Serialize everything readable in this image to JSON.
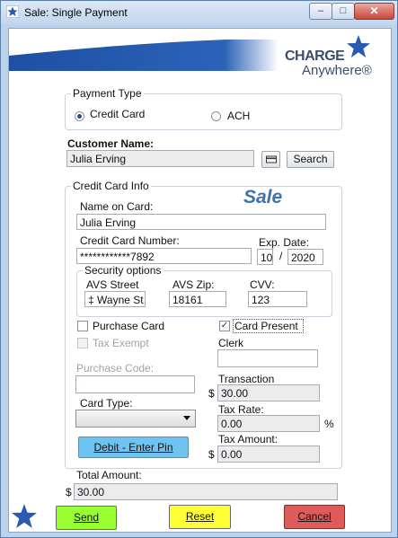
{
  "window": {
    "title": "Sale: Single Payment",
    "minimize_glyph": "–",
    "maximize_glyph": "□",
    "close_glyph": "✕"
  },
  "brand": {
    "line1": "CHARGE",
    "line2": "Anywhere®"
  },
  "colors": {
    "banner": "#1e4fa4",
    "star": "#2a5bb0",
    "debit_button": "#6ec3f0",
    "send_button": "#99ff33",
    "reset_button": "#ffff33",
    "cancel_button": "#e05a5a"
  },
  "payment_type": {
    "legend": "Payment Type",
    "options": [
      {
        "label": "Credit Card",
        "selected": true
      },
      {
        "label": "ACH",
        "selected": false
      }
    ]
  },
  "customer": {
    "label": "Customer Name:",
    "value": "Julia Erving",
    "search_label": "Search",
    "card_icon": "card-icon"
  },
  "card_info": {
    "legend": "Credit Card Info",
    "heading": "Sale",
    "name_label": "Name on Card:",
    "name_value": "Julia Erving",
    "number_label": "Credit Card Number:",
    "number_value": "************7892",
    "exp_label": "Exp. Date:",
    "exp_month": "10",
    "exp_sep": "/",
    "exp_year": "2020",
    "security": {
      "legend": "Security options",
      "street_label": "AVS Street",
      "street_value": "‡ Wayne St",
      "zip_label": "AVS Zip:",
      "zip_value": "18161",
      "cvv_label": "CVV:",
      "cvv_value": "123"
    },
    "purchase_card_label": "Purchase Card",
    "tax_exempt_label": "Tax Exempt",
    "card_present_label": "Card Present",
    "card_present_mark": "✓",
    "clerk_label": "Clerk",
    "clerk_value": "",
    "purchase_code_label": "Purchase Code:",
    "purchase_code_value": "",
    "card_type_label": "Card Type:",
    "card_type_value": "",
    "debit_label": "Debit - Enter Pin",
    "transaction_label": "Transaction",
    "transaction_value": "30.00",
    "tax_rate_label": "Tax Rate:",
    "tax_rate_value": "0.00",
    "percent": "%",
    "tax_amount_label": "Tax Amount:",
    "tax_amount_value": "0.00",
    "currency": "$"
  },
  "total": {
    "label": "Total Amount:",
    "currency": "$",
    "value": "30.00"
  },
  "actions": {
    "send": "Send",
    "reset": "Reset",
    "cancel": "Cancel"
  }
}
